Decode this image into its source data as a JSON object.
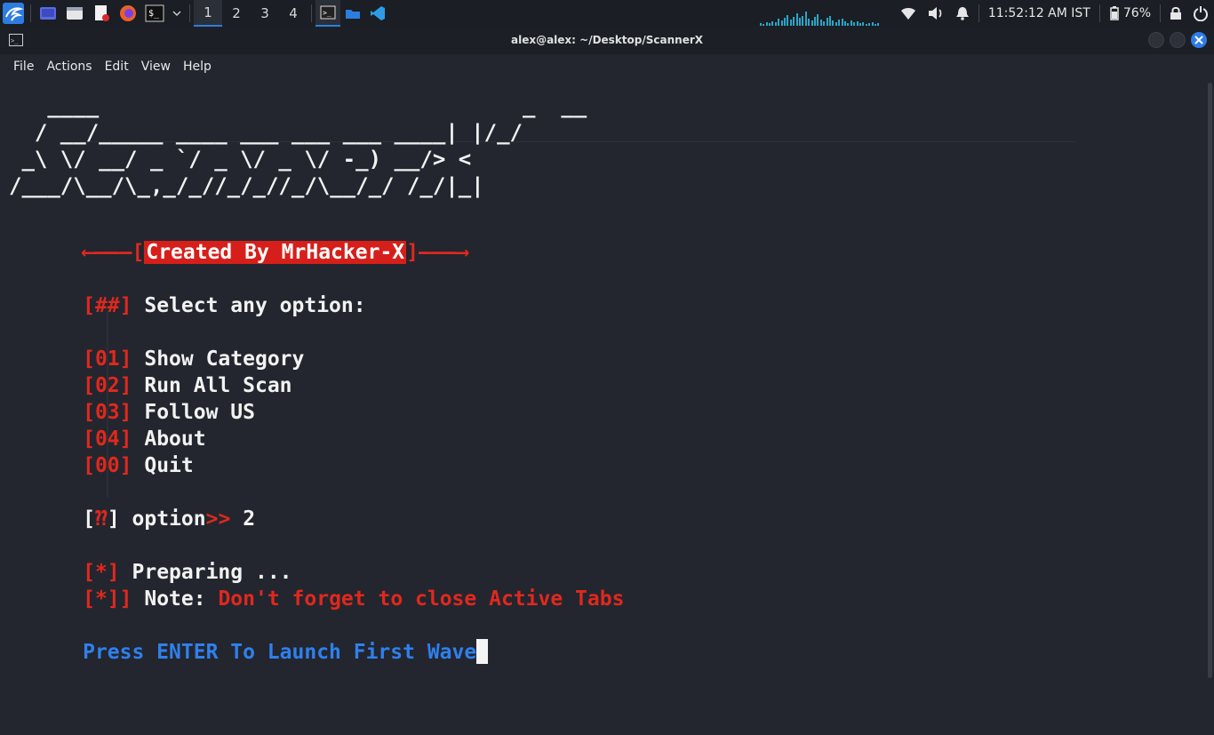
{
  "panel": {
    "workspaces": [
      "1",
      "2",
      "3",
      "4"
    ],
    "active_workspace": "1",
    "clock": "11:52:12 AM IST",
    "battery": "76%",
    "colors": {
      "accent": "#2d7de0",
      "panel_bg": "#1b1e24",
      "graph": "#2aa6c9"
    }
  },
  "window": {
    "title": "alex@alex: ~/Desktop/ScannerX",
    "menu": [
      "File",
      "Actions",
      "Edit",
      "View",
      "Help"
    ]
  },
  "terminal": {
    "ascii_art": [
      "   ____                                 _  __",
      "  / __/_____ ____ ___ ___ ___ ____| |/_/",
      " _\\ \\/ __/ _ `/ _ \\/ _ \\/ -_) __/> <",
      "/___/\\__/\\_,_/_//_/_//_/\\__/_/ /_/|_|"
    ],
    "banner_left_arrow": "⟵———[",
    "banner_text": "Created By MrHacker-X",
    "banner_right_arrow": "]———⟶",
    "prompt_tag": "[##]",
    "prompt_text": "Select any option:",
    "options": [
      {
        "num": "[01]",
        "label": "Show Category"
      },
      {
        "num": "[02]",
        "label": "Run All Scan"
      },
      {
        "num": "[03]",
        "label": "Follow US"
      },
      {
        "num": "[04]",
        "label": "About"
      },
      {
        "num": "[00]",
        "label": "Quit"
      }
    ],
    "input_open": "[",
    "input_q": "⁇",
    "input_close": "]",
    "input_label": "option",
    "input_arrow": ">>",
    "input_value": "2",
    "status_tag": "[*]",
    "status_text": "Preparing ...",
    "note_tag": "[*]]",
    "note_label": "Note:",
    "note_text": "Don't forget to close Active Tabs",
    "launch_text": "Press ENTER To Launch First Wave",
    "colors": {
      "red": "#e0281e",
      "blue": "#2f80ed",
      "banner_bg": "#d61f1a"
    }
  }
}
